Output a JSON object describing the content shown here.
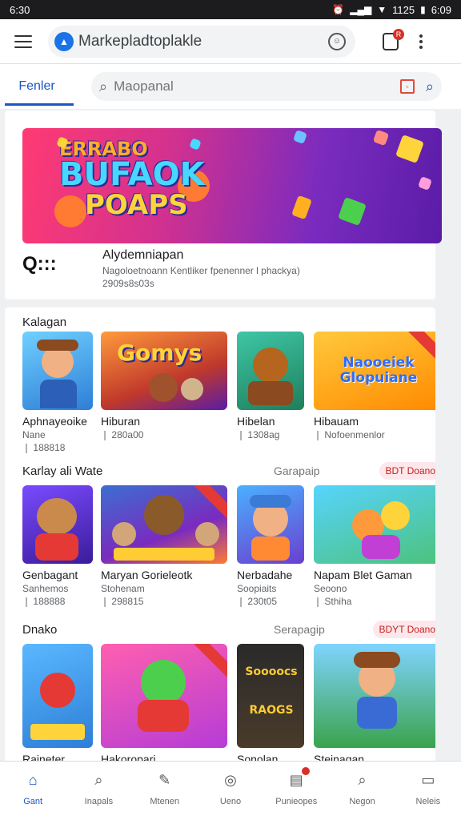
{
  "status_bar": {
    "time": "6:30",
    "right_text": "1125",
    "clock": "6:09"
  },
  "app_bar": {
    "url": "Markepladtoplakle",
    "cart_badge": "R"
  },
  "tabs": {
    "active_label": "Fenler"
  },
  "search": {
    "placeholder": "Maopanal"
  },
  "promo": {
    "banner_line1": "ERRABO",
    "banner_line2": "BUFAOK",
    "banner_line3": "POAPS",
    "icon_text": "Q:::",
    "title": "Alydemniapan",
    "subtitle": "Nagoloetnoann Kentliker fpenenner l phackya)",
    "meta": "2909s8s03s"
  },
  "sections": [
    {
      "title": "Kalagan",
      "more": "",
      "badge": "",
      "items": [
        {
          "title": "Aphnayeoike",
          "sub": "Nane",
          "meta": "❘ 188818",
          "art": ""
        },
        {
          "title": "Hiburan",
          "sub": "",
          "meta": "❘ 280a00",
          "art": "Gomys"
        },
        {
          "title": "Hibelan",
          "sub": "",
          "meta": "❘ 1308ag",
          "art": ""
        },
        {
          "title": "Hibauam",
          "sub": "",
          "meta": "❘ Nofoenmenlor",
          "art": "Naooeiek Glopuiane"
        }
      ]
    },
    {
      "title": "Karlay ali Wate",
      "more": "Garapaip",
      "badge": "BDT Doano",
      "items": [
        {
          "title": "Genbagant",
          "sub": "Sanhemos",
          "meta": "❘ 188888",
          "art": ""
        },
        {
          "title": "Maryan Gorieleotk",
          "sub": "Stohenam",
          "meta": "❘ 298815",
          "art": ""
        },
        {
          "title": "Nerbadahe",
          "sub": "Soopiaits",
          "meta": "❘ 230t05",
          "art": ""
        },
        {
          "title": "Napam Blet Gaman",
          "sub": "Seoono",
          "meta": "❘ Sthiha",
          "art": ""
        }
      ]
    },
    {
      "title": "Dnako",
      "more": "Serapagip",
      "badge": "BDYT Doano",
      "items": [
        {
          "title": "Raineter",
          "sub": "",
          "meta": "",
          "art": ""
        },
        {
          "title": "Hakoropari",
          "sub": "",
          "meta": "",
          "art": ""
        },
        {
          "title": "Sonolan",
          "sub": "",
          "meta": "",
          "art": "Soooocs RAOGS"
        },
        {
          "title": "Steinagan",
          "sub": "",
          "meta": "",
          "art": ""
        }
      ]
    }
  ],
  "bottom_nav": [
    {
      "label": "Gant",
      "icon": "home-icon"
    },
    {
      "label": "Inapals",
      "icon": "search-icon"
    },
    {
      "label": "Mtenen",
      "icon": "edit-icon"
    },
    {
      "label": "Ueno",
      "icon": "gift-icon"
    },
    {
      "label": "Punieopes",
      "icon": "chart-icon"
    },
    {
      "label": "Negon",
      "icon": "search-icon"
    },
    {
      "label": "Neleis",
      "icon": "ticket-icon"
    }
  ]
}
